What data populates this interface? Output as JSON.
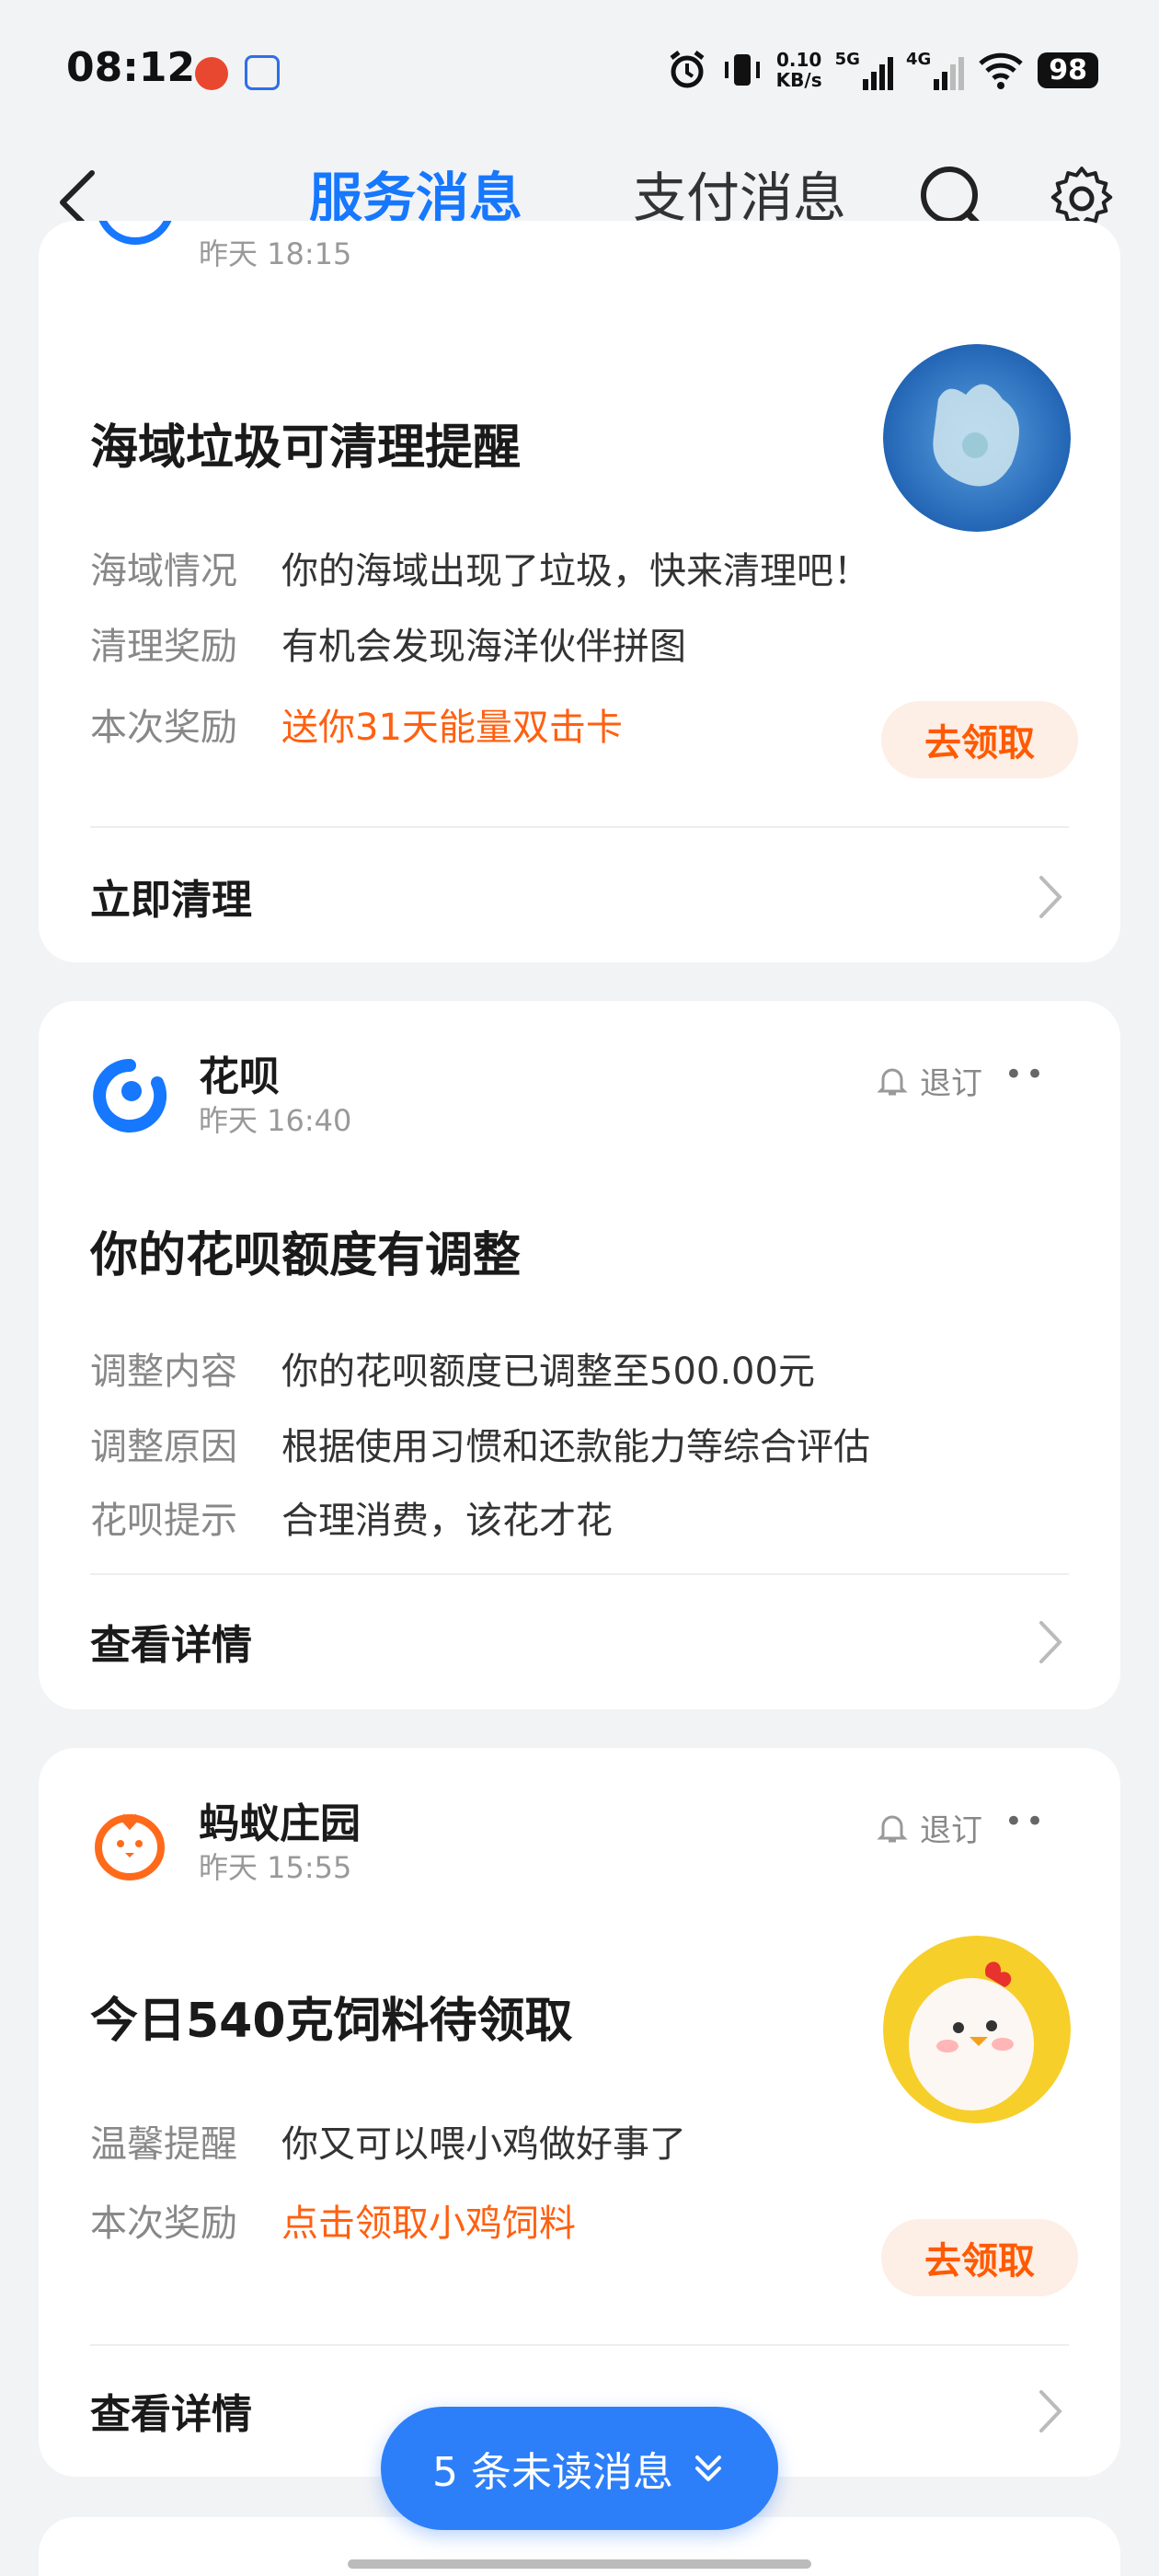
{
  "status_bar": {
    "time": "08:12",
    "net_speed_value": "0.10",
    "net_speed_unit": "KB/s",
    "sig1": "5G",
    "sig2": "4G",
    "battery": "98"
  },
  "header": {
    "tab_service": "服务消息",
    "tab_payment": "支付消息"
  },
  "card1": {
    "time": "昨天 18:15",
    "title": "海域垃圾可清理提醒",
    "rows": [
      {
        "label": "海域情况",
        "value": "你的海域出现了垃圾，快来清理吧！"
      },
      {
        "label": "清理奖励",
        "value": "有机会发现海洋伙伴拼图"
      },
      {
        "label": "本次奖励",
        "value": "送你31天能量双击卡"
      }
    ],
    "claim_label": "去领取",
    "action": "立即清理"
  },
  "card2": {
    "source": "花呗",
    "time": "昨天 16:40",
    "unsubscribe": "退订",
    "more": "••",
    "title": "你的花呗额度有调整",
    "rows": [
      {
        "label": "调整内容",
        "value": "你的花呗额度已调整至500.00元"
      },
      {
        "label": "调整原因",
        "value": "根据使用习惯和还款能力等综合评估"
      },
      {
        "label": "花呗提示",
        "value": "合理消费，该花才花"
      }
    ],
    "action": "查看详情"
  },
  "card3": {
    "source": "蚂蚁庄园",
    "time": "昨天 15:55",
    "unsubscribe": "退订",
    "more": "••",
    "title": "今日540克饲料待领取",
    "rows": [
      {
        "label": "温馨提醒",
        "value": "你又可以喂小鸡做好事了"
      },
      {
        "label": "本次奖励",
        "value": "点击领取小鸡饲料"
      }
    ],
    "claim_label": "去领取",
    "action": "查看详情"
  },
  "unread": {
    "label": "5 条未读消息"
  },
  "colors": {
    "accent": "#1677ff",
    "reward_orange": "#ff6010",
    "claim_bg": "#fdeee6",
    "unread_bg": "#2d7ff9"
  }
}
